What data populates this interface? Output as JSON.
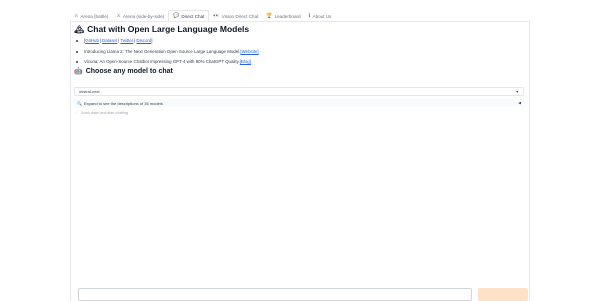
{
  "tabs": [
    {
      "icon": "⚔",
      "label": "Arena (battle)",
      "icon_name": "swords-icon"
    },
    {
      "icon": "⚔",
      "label": "Arena (side-by-side)",
      "icon_name": "swords-icon"
    },
    {
      "icon": "💬",
      "label": "Direct Chat",
      "icon_name": "chat-icon"
    },
    {
      "icon": "👀",
      "label": "Vision Direct Chat",
      "icon_name": "eyes-icon"
    },
    {
      "icon": "🏆",
      "label": "Leaderboard",
      "icon_name": "trophy-icon"
    },
    {
      "icon": "ℹ",
      "label": "About Us",
      "icon_name": "info-icon"
    }
  ],
  "active_tab": 2,
  "header": {
    "title": "Chat with Open Large Language Models",
    "title_icon": "🏔"
  },
  "links": {
    "github": "GitHub",
    "dataset": "Dataset",
    "twitter": "Twitter",
    "discord": "Discord",
    "sep": "|"
  },
  "bullets": [
    {
      "text": "Introducing Llama 2: The Next Generation Open Source Large Language Model. ",
      "link": "[Website]"
    },
    {
      "text": "Vicuna: An Open-Source Chatbot Impressing GPT-4 with 90% ChatGPT Quality. ",
      "link": "[Blog]"
    }
  ],
  "section": {
    "title": "Choose any model to chat",
    "icon": "🤖"
  },
  "model_select": {
    "value": "mistral-next"
  },
  "expander": {
    "label": "Expand to see the descriptions of 35 models",
    "icon": "🔍"
  },
  "notice": {
    "text": "Scroll down and start chatting"
  },
  "input": {
    "placeholder": "",
    "send_label": ""
  },
  "colors": {
    "accent": "#fde2c8",
    "link": "#2563eb",
    "border": "#e5e7eb"
  }
}
